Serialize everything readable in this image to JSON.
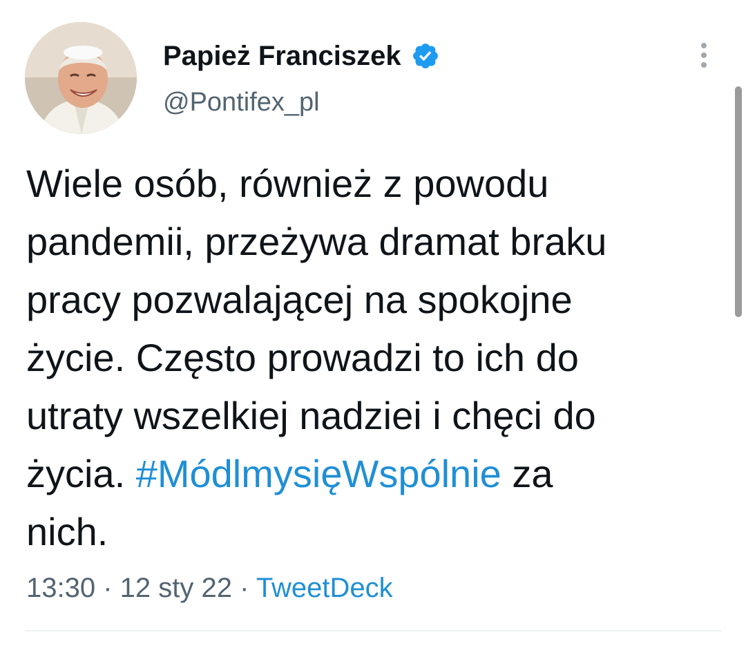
{
  "author": {
    "display_name": "Papież Franciszek",
    "handle": "@Pontifex_pl",
    "verified_icon": "verified-badge-icon",
    "avatar": "profile-photo"
  },
  "tweet": {
    "lines": [
      "Wiele osób, również z powodu",
      "pandemii, przeżywa dramat braku",
      "pracy pozwalającej na spokojne",
      "życie. Często prowadzi to ich do",
      "utraty wszelkiej nadziei i chęci do"
    ],
    "line6_before": "życia. ",
    "hashtag": "#MódlmysięWspólnie",
    "line6_after": " za",
    "line7": "nich."
  },
  "meta": {
    "time": "13:30",
    "separator": " · ",
    "date": "12 sty 22",
    "source": "TweetDeck"
  },
  "colors": {
    "link": "#1f8fd6",
    "secondary_text": "#536471",
    "verified": "#1d9bf0"
  }
}
